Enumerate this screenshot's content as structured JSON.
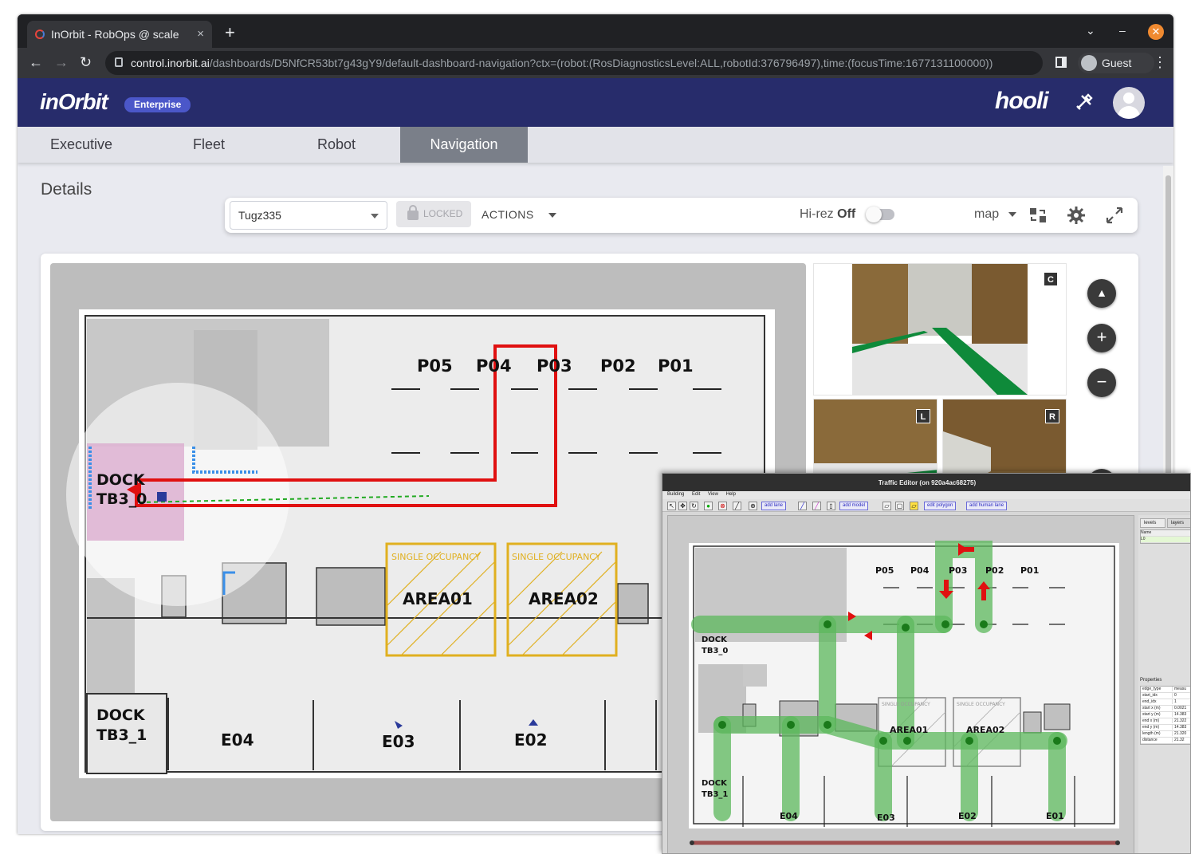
{
  "browser": {
    "tab_title": "InOrbit - RobOps @ scale",
    "tab_close": "×",
    "new_tab": "+",
    "url_host": "control.inorbit.ai",
    "url_path": "/dashboards/D5NfCR53bt7g43gY9/default-dashboard-navigation?ctx=(robot:(RosDiagnosticsLevel:ALL,robotId:376796497),time:(focusTime:1677131100000))",
    "profile_label": "Guest",
    "back": "←",
    "forward": "→",
    "reload": "↻",
    "menu": "⋮",
    "minimize": "–",
    "chevron": "⌄",
    "close": "✕"
  },
  "app": {
    "brand": "inOrbit",
    "edition_badge": "Enterprise",
    "customer_logo": "hooli",
    "nav_tabs": [
      {
        "label": "Executive",
        "active": false
      },
      {
        "label": "Fleet",
        "active": false
      },
      {
        "label": "Robot",
        "active": false
      },
      {
        "label": "Navigation",
        "active": true
      }
    ],
    "section_title": "Details"
  },
  "controls": {
    "robot_select": "Tugz335",
    "lock_label": "LOCKED",
    "actions_label": "ACTIONS",
    "hirez_label": "Hi-rez",
    "hirez_state": "Off",
    "view_select": "map",
    "icons": [
      "swap-icon",
      "gear-icon",
      "fullscreen-icon"
    ]
  },
  "map": {
    "shelf_labels": [
      "P05",
      "P04",
      "P03",
      "P02",
      "P01"
    ],
    "dock_labels": [
      [
        "DOCK",
        "TB3_0"
      ],
      [
        "DOCK",
        "TB3_1"
      ]
    ],
    "zone_caption": "SINGLE OCCUPANCY",
    "zones": [
      "AREA01",
      "AREA02"
    ],
    "station_labels": [
      "E04",
      "E03",
      "E02"
    ],
    "colors": {
      "path": "#e01010",
      "plan": "#22aa22",
      "lidar": "#3a8fe8",
      "zone": "#e0b020"
    }
  },
  "cameras": [
    "C",
    "L",
    "R"
  ],
  "map_controls": {
    "compass": "▲",
    "zoom_in": "+",
    "zoom_out": "−",
    "link": "⚭"
  },
  "traffic_editor": {
    "title": "Traffic Editor (on 920a4ac68275)",
    "menu": [
      "Building",
      "Edit",
      "View",
      "Help"
    ],
    "tool_labels": [
      "add lane",
      "add model",
      "edit polygon",
      "add human lane"
    ],
    "side_tabs": [
      "levels",
      "layers"
    ],
    "levels_header": "Name",
    "level_value": "L0",
    "properties_title": "Properties",
    "properties": [
      {
        "k": "edge_type",
        "v": "measu"
      },
      {
        "k": "start_idx",
        "v": "0"
      },
      {
        "k": "end_idx",
        "v": "1"
      },
      {
        "k": "start x (m)",
        "v": "0.0021"
      },
      {
        "k": "start y (m)",
        "v": "14.383"
      },
      {
        "k": "end x (m)",
        "v": "21.322"
      },
      {
        "k": "end y (m)",
        "v": "14.383"
      },
      {
        "k": "length (m)",
        "v": "21.320"
      },
      {
        "k": "distance",
        "v": "21.32"
      }
    ],
    "shelf_labels": [
      "P05",
      "P04",
      "P03",
      "P02",
      "P01"
    ],
    "dock_labels": [
      [
        "DOCK",
        "TB3_0"
      ],
      [
        "DOCK",
        "TB3_1"
      ]
    ],
    "zone_caption": "SINGLE OCCUPANCY",
    "zones": [
      "AREA01",
      "AREA02"
    ],
    "station_labels": [
      "E04",
      "E03",
      "E02",
      "E01"
    ]
  }
}
